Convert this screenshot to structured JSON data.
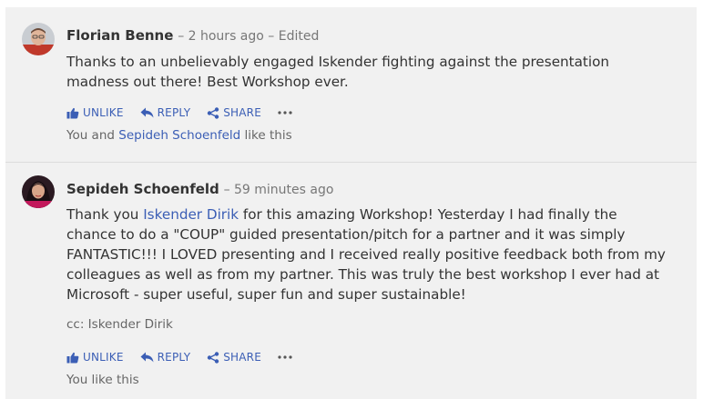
{
  "comments": [
    {
      "author": "Florian Benne",
      "meta": "– 2 hours ago – Edited",
      "text": "Thanks to an unbelievably engaged Iskender fighting against the presentation madness out there! Best Workshop ever.",
      "actions": {
        "like": "UNLIKE",
        "reply": "REPLY",
        "share": "SHARE"
      },
      "likes_prefix": "You and",
      "likes_person": "Sepideh Schoenfeld",
      "likes_suffix": "like this"
    },
    {
      "author": "Sepideh Schoenfeld",
      "meta": "– 59 minutes ago",
      "text_before": "Thank you",
      "mention": "Iskender Dirik",
      "text_after": "for this amazing Workshop! Yesterday I had finally the chance to do a \"COUP\" guided presentation/pitch for a partner and it was simply FANTASTIC!!! I LOVED presenting and I received really positive feedback both from my colleagues as well as from my partner. This was truly the best workshop I ever had at Microsoft - super useful, super fun and super sustainable!",
      "cc": "cc: Iskender Dirik",
      "actions": {
        "like": "UNLIKE",
        "reply": "REPLY",
        "share": "SHARE"
      },
      "likes": "You like this"
    }
  ],
  "colors": {
    "link": "#3b5eb5",
    "text": "#333333",
    "muted": "#777777",
    "background": "#f1f1f1"
  },
  "icons": {
    "like": "thumbs-up-icon",
    "reply": "reply-arrow-icon",
    "share": "share-icon",
    "more": "more-ellipsis-icon"
  }
}
